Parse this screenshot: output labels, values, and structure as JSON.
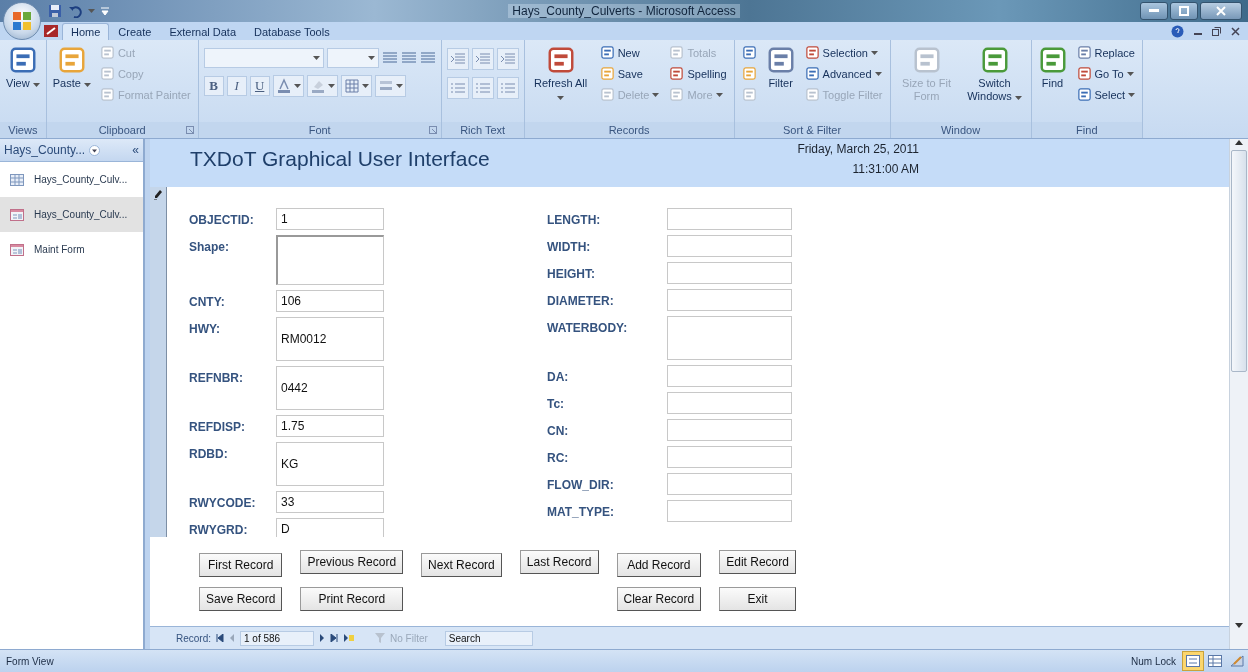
{
  "window": {
    "title": "Hays_County_Culverts - Microsoft Access"
  },
  "ribbon": {
    "tabs": [
      {
        "label": "Home",
        "selected": true
      },
      {
        "label": "Create",
        "selected": false
      },
      {
        "label": "External Data",
        "selected": false
      },
      {
        "label": "Database Tools",
        "selected": false
      }
    ],
    "groups": [
      {
        "kind": "commands",
        "label": "Views",
        "commands": [
          {
            "kind": "large",
            "label": "View",
            "disabled": false,
            "dropdown": true
          }
        ]
      },
      {
        "kind": "commands",
        "label": "Clipboard",
        "launcher": true,
        "commands": [
          {
            "kind": "large",
            "label": "Paste",
            "disabled": false,
            "dropdown": true
          },
          {
            "kind": "small",
            "label": "Cut",
            "disabled": true,
            "dropdown": false
          },
          {
            "kind": "small",
            "label": "Copy",
            "disabled": true,
            "dropdown": false
          },
          {
            "kind": "small",
            "label": "Format Painter",
            "disabled": true,
            "dropdown": false
          }
        ]
      },
      {
        "kind": "font",
        "label": "Font",
        "launcher": true,
        "format_buttons": [
          "B",
          "I",
          "U"
        ]
      },
      {
        "kind": "icons",
        "label": "Rich Text"
      },
      {
        "kind": "commands",
        "label": "Records",
        "commands": [
          {
            "kind": "large",
            "label": "Refresh All",
            "disabled": false,
            "dropdown": true
          },
          {
            "kind": "small",
            "label": "New",
            "disabled": false,
            "dropdown": false
          },
          {
            "kind": "small",
            "label": "Save",
            "disabled": false,
            "dropdown": false
          },
          {
            "kind": "small",
            "label": "Delete",
            "disabled": true,
            "dropdown": true
          },
          {
            "kind": "small",
            "label": "Totals",
            "disabled": true,
            "dropdown": false
          },
          {
            "kind": "small",
            "label": "Spelling",
            "disabled": false,
            "dropdown": false
          },
          {
            "kind": "small",
            "label": "More",
            "disabled": true,
            "dropdown": true
          }
        ]
      },
      {
        "kind": "commands",
        "label": "Sort & Filter",
        "commands": [
          {
            "kind": "icon",
            "disabled": false
          },
          {
            "kind": "icon",
            "disabled": false
          },
          {
            "kind": "icon",
            "disabled": true
          },
          {
            "kind": "large",
            "label": "Filter",
            "disabled": false,
            "dropdown": false
          },
          {
            "kind": "small",
            "label": "Selection",
            "disabled": false,
            "dropdown": true
          },
          {
            "kind": "small",
            "label": "Advanced",
            "disabled": false,
            "dropdown": true
          },
          {
            "kind": "small",
            "label": "Toggle Filter",
            "disabled": true,
            "dropdown": false
          }
        ]
      },
      {
        "kind": "commands",
        "label": "Window",
        "commands": [
          {
            "kind": "large",
            "label": "Size to Fit Form",
            "disabled": true,
            "dropdown": false
          },
          {
            "kind": "large",
            "label": "Switch Windows",
            "disabled": false,
            "dropdown": true
          }
        ]
      },
      {
        "kind": "commands",
        "label": "Find",
        "commands": [
          {
            "kind": "large",
            "label": "Find",
            "disabled": false,
            "dropdown": false
          },
          {
            "kind": "small",
            "label": "Replace",
            "disabled": false,
            "dropdown": false
          },
          {
            "kind": "small",
            "label": "Go To",
            "disabled": false,
            "dropdown": true
          },
          {
            "kind": "small",
            "label": "Select",
            "disabled": false,
            "dropdown": true
          }
        ]
      }
    ]
  },
  "nav_pane": {
    "title": "Hays_County...",
    "collapse": "«",
    "items": [
      {
        "kind": "table",
        "label": "Hays_County_Culv...",
        "selected": false
      },
      {
        "kind": "form",
        "label": "Hays_County_Culv...",
        "selected": true
      },
      {
        "kind": "form",
        "label": "Maint Form",
        "selected": false
      }
    ]
  },
  "form": {
    "title": "TXDoT Graphical User Interface",
    "date": "Friday, March 25, 2011",
    "time": "11:31:00 AM",
    "left_fields": [
      {
        "kind": "single",
        "label": "OBJECTID:",
        "value": "1"
      },
      {
        "kind": "image",
        "label": "Shape:"
      },
      {
        "kind": "single",
        "label": "CNTY:",
        "value": "106"
      },
      {
        "kind": "tall",
        "label": "HWY:",
        "value": "RM0012"
      },
      {
        "kind": "tall",
        "label": "REFNBR:",
        "value": "0442"
      },
      {
        "kind": "single",
        "label": "REFDISP:",
        "value": "1.75"
      },
      {
        "kind": "tall",
        "label": "RDBD:",
        "value": "KG"
      },
      {
        "kind": "single",
        "label": "RWYCODE:",
        "value": "33"
      },
      {
        "kind": "single",
        "label": "RWYGRD:",
        "value": "D"
      }
    ],
    "right_fields": [
      {
        "kind": "single",
        "label": "LENGTH:"
      },
      {
        "kind": "single",
        "label": "WIDTH:"
      },
      {
        "kind": "single",
        "label": "HEIGHT:"
      },
      {
        "kind": "single",
        "label": "DIAMETER:"
      },
      {
        "kind": "tall",
        "label": "WATERBODY:"
      },
      {
        "kind": "single",
        "label": "DA:"
      },
      {
        "kind": "single",
        "label": "Tc:"
      },
      {
        "kind": "single",
        "label": "CN:"
      },
      {
        "kind": "single",
        "label": "RC:"
      },
      {
        "kind": "single",
        "label": "FLOW_DIR:"
      },
      {
        "kind": "single",
        "label": "MAT_TYPE:"
      }
    ],
    "buttons_row_1": [
      "First Record",
      "Previous Record",
      "Next Record",
      "Last Record",
      "Add Record",
      "Edit Record"
    ],
    "buttons_row_2": [
      "Save Record",
      "Print Record",
      "Clear Record",
      "Exit"
    ]
  },
  "record_nav": {
    "label": "Record:",
    "position": "1 of 586",
    "filter": "No Filter",
    "search": {
      "placeholder": "Search"
    }
  },
  "status_bar": {
    "text": "Form View",
    "num_lock": "Num Lock",
    "views": [
      {
        "kind": "form",
        "selected": true
      },
      {
        "kind": "datasheet",
        "selected": false
      },
      {
        "kind": "design",
        "selected": false
      }
    ]
  }
}
